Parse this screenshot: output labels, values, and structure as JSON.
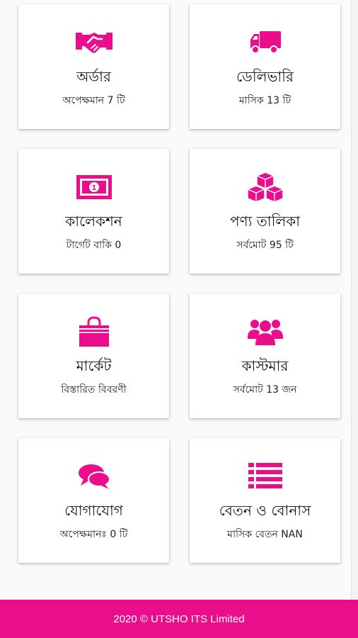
{
  "accent_color": "#ea0d8c",
  "cards": [
    {
      "title": "অর্ডার",
      "subtitle": "অপেক্ষমান 7 টি",
      "icon": "handshake-icon"
    },
    {
      "title": "ডেলিভারি",
      "subtitle": "মাসিক 13 টি",
      "icon": "truck-icon"
    },
    {
      "title": "কালেকশন",
      "subtitle": "টার্গেট বাকি 0",
      "icon": "money-bill-icon"
    },
    {
      "title": "পণ্য তালিকা",
      "subtitle": "সর্বমোট 95 টি",
      "icon": "cubes-icon"
    },
    {
      "title": "মার্কেট",
      "subtitle": "বিস্তারিত বিবরণী",
      "icon": "shopping-bag-icon"
    },
    {
      "title": "কাস্টমার",
      "subtitle": "সর্বমোট 13 জন",
      "icon": "users-icon"
    },
    {
      "title": "যোগাযোগ",
      "subtitle": "অপেক্ষমানঃ 0 টি",
      "icon": "chat-bubbles-icon"
    },
    {
      "title": "বেতন ও বোনাস",
      "subtitle": "মাসিক বেতন NAN",
      "icon": "list-icon"
    }
  ],
  "footer": {
    "text": "2020 © UTSHO ITS Limited"
  }
}
